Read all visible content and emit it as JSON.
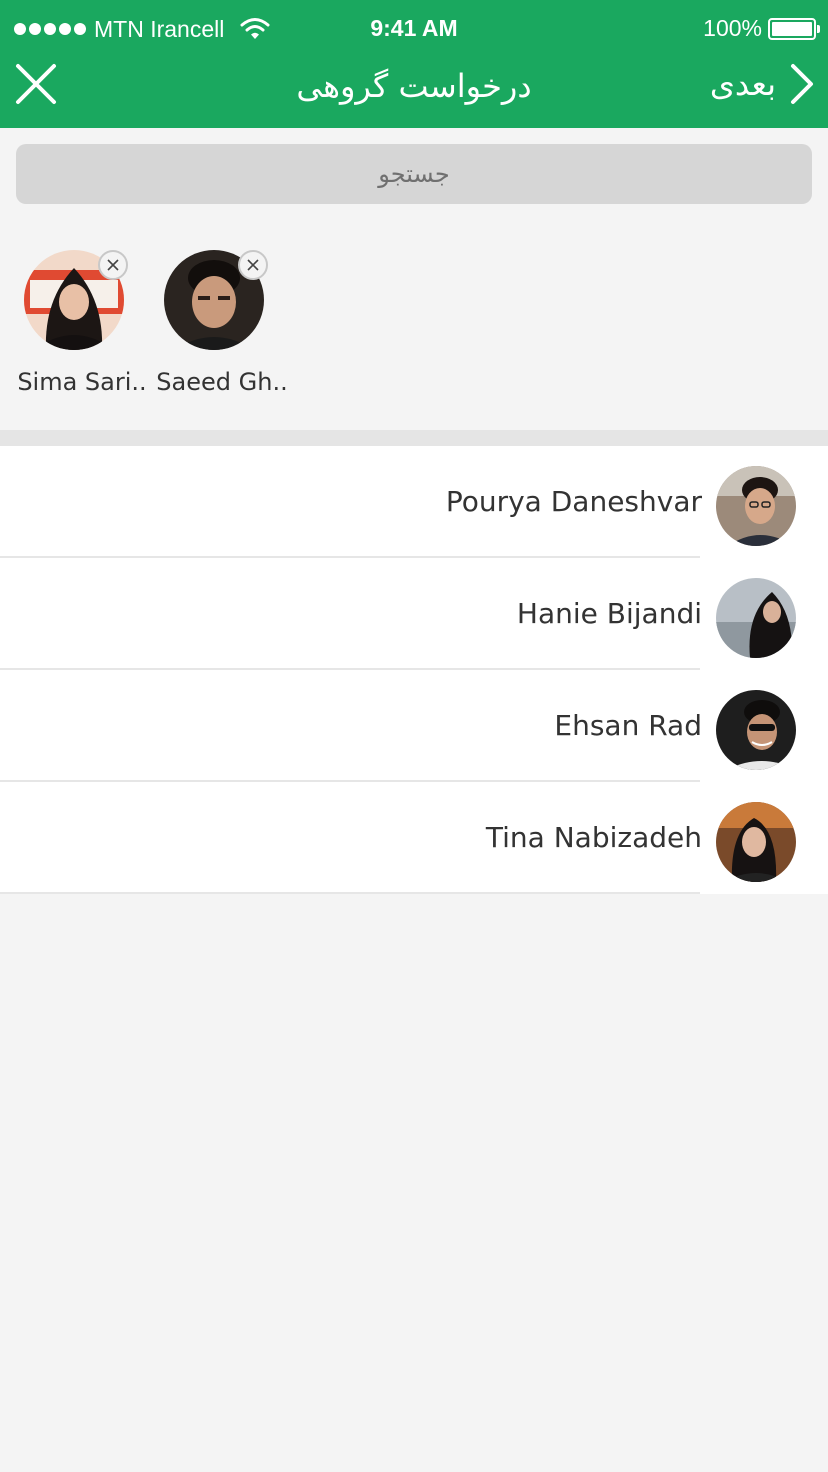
{
  "status_bar": {
    "carrier": "MTN Irancell",
    "time": "9:41 AM",
    "battery": "100%"
  },
  "header": {
    "title": "درخواست گروهی",
    "next_label": "بعدی",
    "background_color": "#1aa85f"
  },
  "search": {
    "placeholder": "جستجو"
  },
  "selected": [
    {
      "name": "Sima Sari..",
      "avatar_icon": "user-photo-icon"
    },
    {
      "name": "Saeed Gh..",
      "avatar_icon": "user-photo-icon"
    }
  ],
  "contacts": [
    {
      "name": "Pourya Daneshvar"
    },
    {
      "name": "Hanie Bijandi"
    },
    {
      "name": "Ehsan Rad"
    },
    {
      "name": "Tina Nabizadeh"
    }
  ]
}
